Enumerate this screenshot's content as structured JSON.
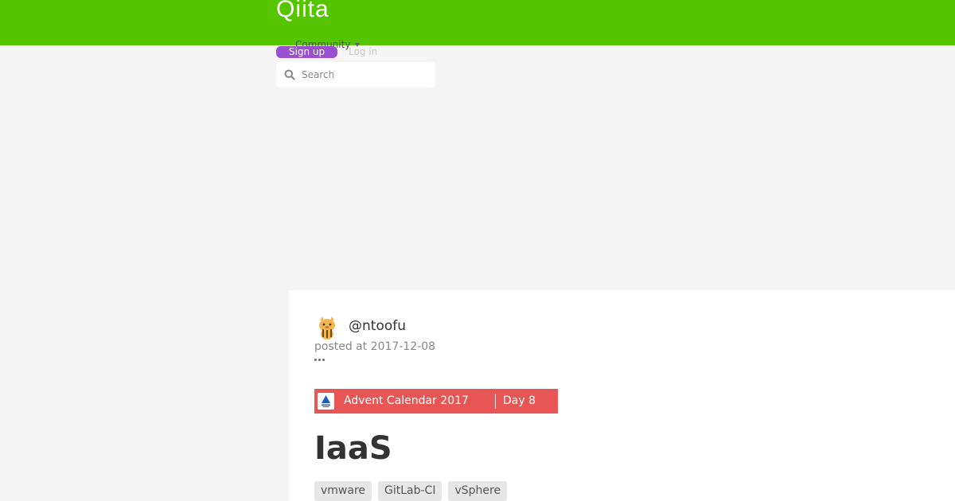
{
  "header": {
    "logo": "Qiita",
    "community_label": "Community",
    "signup_label": "Sign up",
    "login_label": "Log in"
  },
  "search": {
    "placeholder": "Search",
    "value": ""
  },
  "article": {
    "author": "@ntoofu",
    "posted": "posted at 2017-12-08",
    "advent_calendar": {
      "title": "Advent Calendar 2017",
      "day": "Day 8"
    },
    "title": "IaaS",
    "tags": [
      "vmware",
      "GitLab-CI",
      "vSphere"
    ]
  },
  "colors": {
    "header_bg": "#55c500",
    "signup_bg": "#9a4fd0",
    "advent_bg": "#e85555",
    "page_bg": "#f5f5f5"
  }
}
